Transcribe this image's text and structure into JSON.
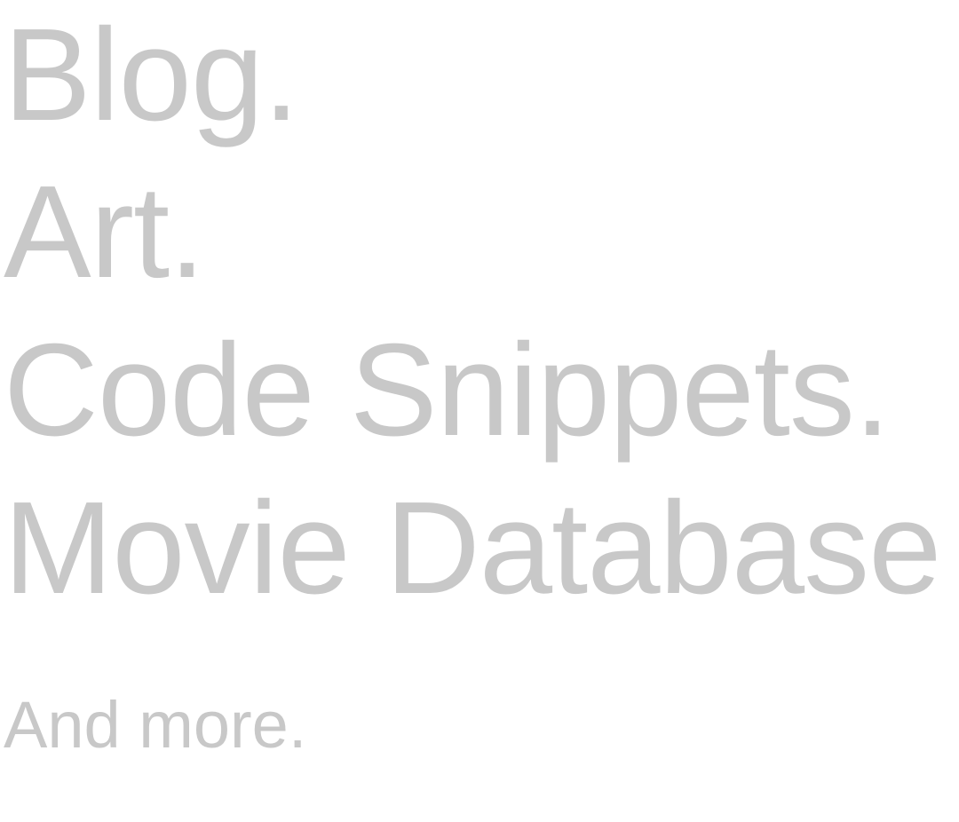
{
  "nav": {
    "items": [
      {
        "label": "Blog."
      },
      {
        "label": "Art."
      },
      {
        "label": "Code Snippets."
      },
      {
        "label": "Movie Database"
      }
    ],
    "more_label": "And more."
  },
  "colors": {
    "text": "#c8c8c8",
    "background": "#ffffff"
  }
}
